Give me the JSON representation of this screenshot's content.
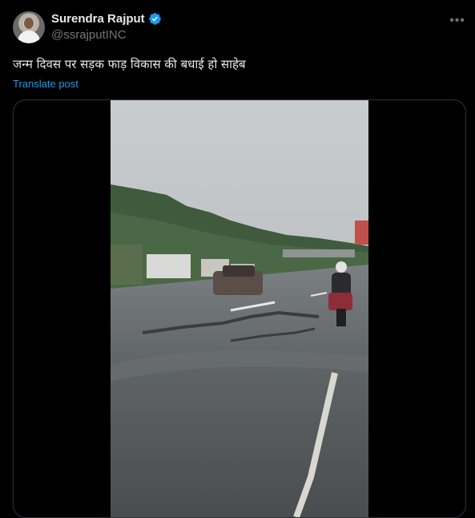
{
  "author": {
    "display_name": "Surendra Rajput",
    "handle": "@ssrajputINC"
  },
  "post": {
    "text": "जन्म दिवस पर सड़क फाड़ विकास की बधाई हो साहेब",
    "translate_label": "Translate post"
  },
  "icons": {
    "verified": "verified-badge-icon",
    "more": "more-options-icon"
  },
  "colors": {
    "background": "#000000",
    "link": "#1d9bf0",
    "verified": "#1d9bf0",
    "secondary_text": "#71767b"
  }
}
